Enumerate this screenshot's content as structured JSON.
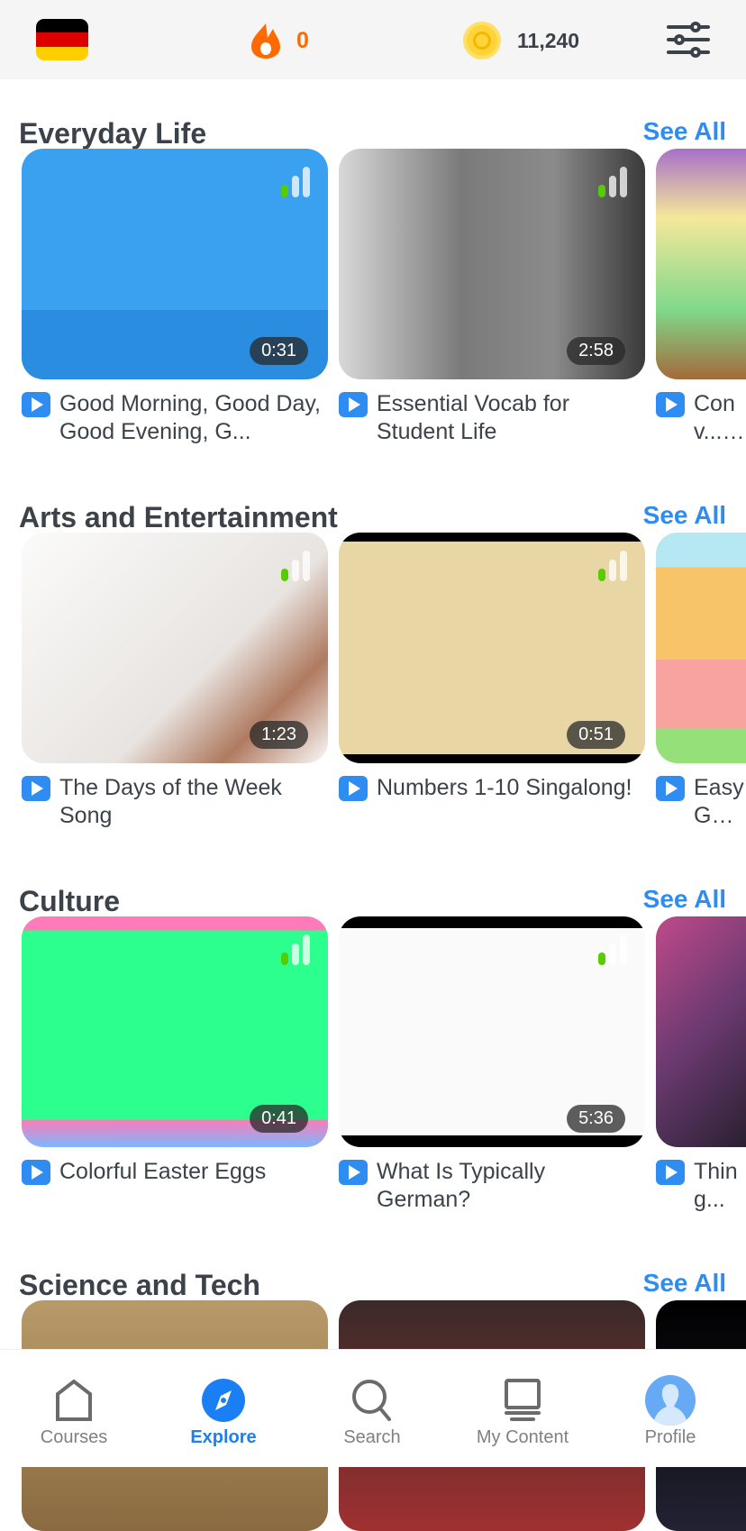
{
  "header": {
    "course_flag": "german-flag-icon",
    "streak_count": "0",
    "coin_count": "11,240",
    "settings_icon": "sliders-icon"
  },
  "colors": {
    "accent": "#2f8cf0",
    "streak": "#ff6a00",
    "text": "#3c4249",
    "difficulty_on": "#58cc02"
  },
  "sections": [
    {
      "title": "Everyday Life",
      "see_all": "See All",
      "videos": [
        {
          "title": "Good Morning, Good Day, Good Evening, G...",
          "duration": "0:31",
          "difficulty": 1
        },
        {
          "title": "Essential Vocab for Student Life",
          "duration": "2:58",
          "difficulty": 1
        },
        {
          "title": "Conv... Stati...",
          "duration": "",
          "difficulty": 0
        }
      ]
    },
    {
      "title": "Arts and Entertainment",
      "see_all": "See All",
      "videos": [
        {
          "title": "The Days of the Week Song",
          "duration": "1:23",
          "difficulty": 1
        },
        {
          "title": "Numbers 1-10 Singalong!",
          "duration": "0:51",
          "difficulty": 1
        },
        {
          "title": "Easy Germ...",
          "duration": "",
          "difficulty": 0
        }
      ]
    },
    {
      "title": "Culture",
      "see_all": "See All",
      "videos": [
        {
          "title": "Colorful Easter Eggs",
          "duration": "0:41",
          "difficulty": 1
        },
        {
          "title": "What Is Typically German?",
          "duration": "5:36",
          "difficulty": 1
        },
        {
          "title": "Thing...",
          "duration": "",
          "difficulty": 0
        }
      ]
    },
    {
      "title": "Science and Tech",
      "see_all": "See All"
    }
  ],
  "nav": [
    {
      "label": "Courses",
      "icon": "home-icon"
    },
    {
      "label": "Explore",
      "icon": "compass-icon",
      "active": true
    },
    {
      "label": "Search",
      "icon": "search-icon"
    },
    {
      "label": "My Content",
      "icon": "monitor-icon"
    },
    {
      "label": "Profile",
      "icon": "avatar-icon"
    }
  ]
}
